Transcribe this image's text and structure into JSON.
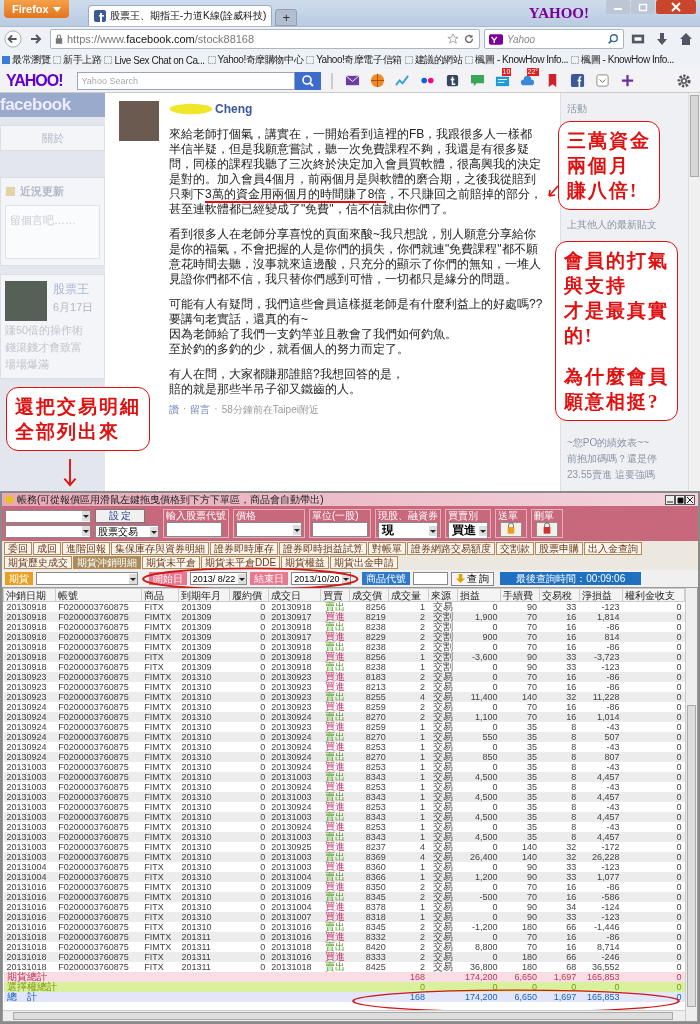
{
  "browser": {
    "menu_button": "Firefox",
    "tabs": [
      {
        "title": "股票王、期指王-力道K線(詮威科技)",
        "selected": true
      }
    ],
    "new_tab": "+",
    "brand": "YAHOO!",
    "url_prefix": "https://www.",
    "url_host": "facebook.com",
    "url_path": "/stock88168",
    "search_placeholder": "Yahoo",
    "bookmarks": [
      {
        "label": "最常瀏覽",
        "kind": "special"
      },
      {
        "label": "新手上路",
        "kind": "page"
      },
      {
        "label": "Live Sex Chat on Ca...",
        "kind": "page"
      },
      {
        "label": "Yahoo!奇摩購物中心",
        "kind": "page"
      },
      {
        "label": "Yahoo!奇摩電子信箱",
        "kind": "page"
      },
      {
        "label": "建議的網站",
        "kind": "page"
      },
      {
        "label": "楓圖 - KnowHow Info...",
        "kind": "page"
      },
      {
        "label": "楓圖 - KnowHow Info...",
        "kind": "page"
      }
    ],
    "toolbar": {
      "logo": "YAHOO!",
      "search_placeholder": "Yahoo Search",
      "news_badge": "10",
      "weather_badge": "22°"
    }
  },
  "facebook": {
    "logo": "facebook",
    "about": "關於",
    "status_tab": "近況更新",
    "status_placeholder": "留個言吧……",
    "side_post": {
      "author": "股票王",
      "date": "6月17日",
      "lines": [
        "賺50倍的操作術",
        "錢滾錢才會致富",
        "場場爆滿"
      ]
    },
    "right_column": [
      "活動",
      "上其他人的最新貼文",
      "~您PO的績效表~~",
      "前抱加碼嗎？還是停",
      "23.55賣進 這要強嗎"
    ]
  },
  "post": {
    "author": "Cheng",
    "paragraphs": [
      {
        "lines": [
          [
            {
              "text": "來給老師打個氣，講實在，一開始看到這裡的FB，我跟很多人一樣都半信半疑，但是我願意嘗試，聽一次免費課程不夠，我還是有很多疑問，同樣的課程我聽了三次終於決定加入會員買軟體，很高興我的決定是對的。加入會員4個月，前兩個月是與軟體的磨合期，之後我從賠到只剩下",
              "underlined": false
            },
            {
              "text": "3萬的資金用兩個月的時間賺了8倍",
              "underlined": true
            },
            {
              "text": "，不只賺回之前賠掉的部分，甚至連軟體都已經變成了\"免費\"，信不信就由你們了。",
              "underlined": false
            }
          ]
        ]
      },
      {
        "lines": [
          [
            {
              "text": "看到很多人在老師分享喜悅的頁面來酸~我只想說，別人願意分享給你是你的福氣，不會把握的人是你們的損失，你們就連\"免費課程\"都不願意花時間去聽，沒事就來這邊酸，只充分的顯示了你們的無知，一堆人見證你們都不信，我只替你們感到可惜，一切都只是緣分的問題。",
              "underlined": false
            }
          ]
        ]
      },
      {
        "lines": [
          [
            {
              "text": "可能有人有疑問，我們這些會員這樣挺老師是有什麼利益上的好處嗎??",
              "underlined": false
            }
          ],
          [
            {
              "text": "要講句老實話，還真的有~",
              "underlined": false
            }
          ],
          [
            {
              "text": "因為老師給了我們一支釣竿並且教會了我們如何釣魚。",
              "underlined": false
            }
          ],
          [
            {
              "text": "至於釣的多釣的少，就看個人的努力而定了。",
              "underlined": false
            }
          ]
        ]
      },
      {
        "lines": [
          [
            {
              "text": "有人在問，大家都賺那誰賠?我想回答的是，",
              "underlined": false
            }
          ],
          [
            {
              "text": "賠的就是那些半吊子卻又鐵齒的人。",
              "underlined": false
            }
          ]
        ]
      }
    ],
    "footer": [
      {
        "text": "讚",
        "kind": "link"
      },
      {
        "text": "·",
        "kind": "dot"
      },
      {
        "text": "留言",
        "kind": "link"
      },
      {
        "text": "·",
        "kind": "dot"
      },
      {
        "text": "58分鐘前在Taipei附近",
        "kind": "time"
      }
    ]
  },
  "annotations": [
    {
      "kind": "profit",
      "blocks": [
        [
          "三萬資金",
          "兩個月",
          "賺八倍!"
        ]
      ]
    },
    {
      "kind": "support",
      "blocks": [
        [
          "會員的打氣",
          "與支持",
          "才是最真實",
          "的!"
        ],
        [
          "為什麼會員",
          "願意相挺?"
        ]
      ]
    },
    {
      "kind": "details",
      "blocks": [
        [
          "還把交易明細",
          "全部列出來"
        ]
      ]
    }
  ],
  "trading_window": {
    "title": "帳務(可從報價區用滑鼠左鍵拖曳價格到下方下單區，商品會自動帶出)",
    "settings_button": "設 定",
    "market_select": "股票交易",
    "groups": [
      {
        "label": "輸入股票代號",
        "kind": "input"
      },
      {
        "label": "價格",
        "kind": "dropdown"
      },
      {
        "label": "單位(一股)",
        "kind": "input"
      },
      {
        "label": "現股、融資券",
        "kind": "select",
        "value": "現"
      },
      {
        "label": "買賣別",
        "kind": "select",
        "value": "買進"
      },
      {
        "label": "送單",
        "kind": "send"
      },
      {
        "label": "刪單",
        "kind": "delete"
      }
    ],
    "tabs": [
      {
        "label": "委回",
        "selected": false
      },
      {
        "label": "成回",
        "selected": false
      },
      {
        "label": "進階回報",
        "selected": false
      },
      {
        "label": "集保庫存與資券明細",
        "selected": false
      },
      {
        "label": "證券即時庫存",
        "selected": false
      },
      {
        "label": "證券即時損益試算",
        "selected": false
      },
      {
        "label": "對帳單",
        "selected": false
      },
      {
        "label": "證券網路交易額度",
        "selected": false
      },
      {
        "label": "交割款",
        "selected": false
      },
      {
        "label": "股票申購",
        "selected": false
      },
      {
        "label": "出入金查詢",
        "selected": false
      },
      {
        "label": "期貨歷史成交",
        "selected": false
      },
      {
        "label": "期貨沖銷明細",
        "selected": true
      },
      {
        "label": "期貨未平倉",
        "selected": false
      },
      {
        "label": "期貨未平倉DDE",
        "selected": false
      },
      {
        "label": "期貨權益",
        "selected": false
      },
      {
        "label": "期貨出金申請",
        "selected": false
      }
    ],
    "filter": {
      "market": "期貨",
      "start_label": "開始日",
      "start_date": "2013/ 8/22",
      "end_label": "結束日",
      "end_date": "2013/10/20",
      "product_label": "商品代號",
      "query_button": "查 詢",
      "last_query": "最後查詢時間：00:09:06"
    },
    "columns": [
      "沖銷日期",
      "帳號",
      "商品",
      "到期年月",
      "履約價",
      "成交日",
      "買賣",
      "成交價",
      "成交量",
      "來源",
      "損益",
      "手續費",
      "交易稅",
      "淨損益",
      "權利金收支"
    ],
    "rows": [
      {
        "kind": "sell",
        "cells": [
          "20130918",
          "F0200003760875",
          "FITX",
          "201309",
          "0",
          "20130918",
          "賣出",
          "8256",
          "1",
          "交易",
          "0",
          "90",
          "33",
          "-123",
          "0"
        ]
      },
      {
        "kind": "buy",
        "cells": [
          "20130918",
          "F0200003760875",
          "FIMTX",
          "201309",
          "0",
          "20130917",
          "買進",
          "8219",
          "2",
          "交割",
          "1,900",
          "70",
          "16",
          "1,814",
          "0"
        ]
      },
      {
        "kind": "sell",
        "cells": [
          "20130918",
          "F0200003760875",
          "FIMTX",
          "201309",
          "0",
          "20130918",
          "賣出",
          "8238",
          "2",
          "交割",
          "0",
          "70",
          "16",
          "-86",
          "0"
        ]
      },
      {
        "kind": "buy",
        "cells": [
          "20130918",
          "F0200003760875",
          "FIMTX",
          "201309",
          "0",
          "20130917",
          "買進",
          "8229",
          "2",
          "交割",
          "900",
          "70",
          "16",
          "814",
          "0"
        ]
      },
      {
        "kind": "sell",
        "cells": [
          "20130918",
          "F0200003760875",
          "FIMTX",
          "201309",
          "0",
          "20130918",
          "賣出",
          "8238",
          "2",
          "交割",
          "0",
          "70",
          "16",
          "-86",
          "0"
        ]
      },
      {
        "kind": "buy",
        "cells": [
          "20130918",
          "F0200003760875",
          "FITX",
          "201309",
          "0",
          "20130918",
          "買進",
          "8256",
          "1",
          "交割",
          "-3,600",
          "90",
          "33",
          "-3,723",
          "0"
        ]
      },
      {
        "kind": "sell",
        "cells": [
          "20130918",
          "F0200003760875",
          "FITX",
          "201309",
          "0",
          "20130918",
          "賣出",
          "8238",
          "1",
          "交割",
          "0",
          "90",
          "33",
          "-123",
          "0"
        ]
      },
      {
        "kind": "buy",
        "cells": [
          "20130923",
          "F0200003760875",
          "FIMTX",
          "201310",
          "0",
          "20130923",
          "買進",
          "8183",
          "2",
          "交易",
          "0",
          "70",
          "16",
          "-86",
          "0"
        ]
      },
      {
        "kind": "buy",
        "cells": [
          "20130923",
          "F0200003760875",
          "FIMTX",
          "201310",
          "0",
          "20130923",
          "買進",
          "8213",
          "2",
          "交易",
          "0",
          "70",
          "16",
          "-86",
          "0"
        ]
      },
      {
        "kind": "sell",
        "cells": [
          "20130923",
          "F0200003760875",
          "FIMTX",
          "201310",
          "0",
          "20130923",
          "賣出",
          "8255",
          "4",
          "交易",
          "11,400",
          "140",
          "32",
          "11,228",
          "0"
        ]
      },
      {
        "kind": "buy",
        "cells": [
          "20130924",
          "F0200003760875",
          "FIMTX",
          "201310",
          "0",
          "20130923",
          "買進",
          "8259",
          "2",
          "交易",
          "0",
          "70",
          "16",
          "-86",
          "0"
        ]
      },
      {
        "kind": "sell",
        "cells": [
          "20130924",
          "F0200003760875",
          "FIMTX",
          "201310",
          "0",
          "20130924",
          "賣出",
          "8270",
          "2",
          "交易",
          "1,100",
          "70",
          "16",
          "1,014",
          "0"
        ]
      },
      {
        "kind": "buy",
        "cells": [
          "20130924",
          "F0200003760875",
          "FIMTX",
          "201310",
          "0",
          "20130923",
          "買進",
          "8259",
          "1",
          "交易",
          "0",
          "35",
          "8",
          "-43",
          "0"
        ]
      },
      {
        "kind": "sell",
        "cells": [
          "20130924",
          "F0200003760875",
          "FIMTX",
          "201310",
          "0",
          "20130924",
          "賣出",
          "8270",
          "1",
          "交易",
          "550",
          "35",
          "8",
          "507",
          "0"
        ]
      },
      {
        "kind": "buy",
        "cells": [
          "20130924",
          "F0200003760875",
          "FIMTX",
          "201310",
          "0",
          "20130924",
          "買進",
          "8253",
          "1",
          "交易",
          "0",
          "35",
          "8",
          "-43",
          "0"
        ]
      },
      {
        "kind": "sell",
        "cells": [
          "20130924",
          "F0200003760875",
          "FIMTX",
          "201310",
          "0",
          "20130924",
          "賣出",
          "8270",
          "1",
          "交易",
          "850",
          "35",
          "8",
          "807",
          "0"
        ]
      },
      {
        "kind": "buy",
        "cells": [
          "20131003",
          "F0200003760875",
          "FIMTX",
          "201310",
          "0",
          "20130924",
          "買進",
          "8253",
          "1",
          "交易",
          "0",
          "35",
          "8",
          "-43",
          "0"
        ]
      },
      {
        "kind": "sell",
        "cells": [
          "20131003",
          "F0200003760875",
          "FIMTX",
          "201310",
          "0",
          "20131003",
          "賣出",
          "8343",
          "1",
          "交易",
          "4,500",
          "35",
          "8",
          "4,457",
          "0"
        ]
      },
      {
        "kind": "buy",
        "cells": [
          "20131003",
          "F0200003760875",
          "FIMTX",
          "201310",
          "0",
          "20130924",
          "買進",
          "8253",
          "1",
          "交易",
          "0",
          "35",
          "8",
          "-43",
          "0"
        ]
      },
      {
        "kind": "sell",
        "cells": [
          "20131003",
          "F0200003760875",
          "FIMTX",
          "201310",
          "0",
          "20131003",
          "賣出",
          "8343",
          "1",
          "交易",
          "4,500",
          "35",
          "8",
          "4,457",
          "0"
        ]
      },
      {
        "kind": "buy",
        "cells": [
          "20131003",
          "F0200003760875",
          "FIMTX",
          "201310",
          "0",
          "20130924",
          "買進",
          "8253",
          "1",
          "交易",
          "0",
          "35",
          "8",
          "-43",
          "0"
        ]
      },
      {
        "kind": "sell",
        "cells": [
          "20131003",
          "F0200003760875",
          "FIMTX",
          "201310",
          "0",
          "20131003",
          "賣出",
          "8343",
          "1",
          "交易",
          "4,500",
          "35",
          "8",
          "4,457",
          "0"
        ]
      },
      {
        "kind": "buy",
        "cells": [
          "20131003",
          "F0200003760875",
          "FIMTX",
          "201310",
          "0",
          "20130924",
          "買進",
          "8253",
          "1",
          "交易",
          "0",
          "35",
          "8",
          "-43",
          "0"
        ]
      },
      {
        "kind": "sell",
        "cells": [
          "20131003",
          "F0200003760875",
          "FIMTX",
          "201310",
          "0",
          "20131003",
          "賣出",
          "8343",
          "1",
          "交易",
          "4,500",
          "35",
          "8",
          "4,457",
          "0"
        ]
      },
      {
        "kind": "buy",
        "cells": [
          "20131003",
          "F0200003760875",
          "FIMTX",
          "201310",
          "0",
          "20130925",
          "買進",
          "8237",
          "4",
          "交易",
          "0",
          "140",
          "32",
          "-172",
          "0"
        ]
      },
      {
        "kind": "sell",
        "cells": [
          "20131003",
          "F0200003760875",
          "FIMTX",
          "201310",
          "0",
          "20131003",
          "賣出",
          "8369",
          "4",
          "交易",
          "26,400",
          "140",
          "32",
          "26,228",
          "0"
        ]
      },
      {
        "kind": "buy",
        "cells": [
          "20131004",
          "F0200003760875",
          "FITX",
          "201310",
          "0",
          "20131003",
          "買進",
          "8360",
          "1",
          "交易",
          "0",
          "90",
          "33",
          "-123",
          "0"
        ]
      },
      {
        "kind": "sell",
        "cells": [
          "20131004",
          "F0200003760875",
          "FITX",
          "201310",
          "0",
          "20131004",
          "賣出",
          "8366",
          "1",
          "交易",
          "1,200",
          "90",
          "33",
          "1,077",
          "0"
        ]
      },
      {
        "kind": "buy",
        "cells": [
          "20131016",
          "F0200003760875",
          "FIMTX",
          "201310",
          "0",
          "20131009",
          "買進",
          "8350",
          "2",
          "交易",
          "0",
          "70",
          "16",
          "-86",
          "0"
        ]
      },
      {
        "kind": "sell",
        "cells": [
          "20131016",
          "F0200003760875",
          "FIMTX",
          "201310",
          "0",
          "20131016",
          "賣出",
          "8345",
          "2",
          "交易",
          "-500",
          "70",
          "16",
          "-586",
          "0"
        ]
      },
      {
        "kind": "buy",
        "cells": [
          "20131016",
          "F0200003760875",
          "FITX",
          "201310",
          "0",
          "20131004",
          "買進",
          "8378",
          "1",
          "交易",
          "0",
          "90",
          "34",
          "-124",
          "0"
        ]
      },
      {
        "kind": "buy",
        "cells": [
          "20131016",
          "F0200003760875",
          "FITX",
          "201310",
          "0",
          "20131007",
          "買進",
          "8318",
          "1",
          "交易",
          "0",
          "90",
          "33",
          "-123",
          "0"
        ]
      },
      {
        "kind": "sell",
        "cells": [
          "20131016",
          "F0200003760875",
          "FITX",
          "201310",
          "0",
          "20131016",
          "賣出",
          "8345",
          "2",
          "交易",
          "-1,200",
          "180",
          "66",
          "-1,446",
          "0"
        ]
      },
      {
        "kind": "buy",
        "cells": [
          "20131018",
          "F0200003760875",
          "FIMTX",
          "201311",
          "0",
          "20131016",
          "買進",
          "8332",
          "2",
          "交易",
          "0",
          "70",
          "16",
          "-86",
          "0"
        ]
      },
      {
        "kind": "sell",
        "cells": [
          "20131018",
          "F0200003760875",
          "FIMTX",
          "201311",
          "0",
          "20131018",
          "賣出",
          "8420",
          "2",
          "交易",
          "8,800",
          "70",
          "16",
          "8,714",
          "0"
        ]
      },
      {
        "kind": "buy",
        "cells": [
          "20131018",
          "F0200003760875",
          "FITX",
          "201311",
          "0",
          "20131016",
          "買進",
          "8333",
          "2",
          "交易",
          "0",
          "180",
          "66",
          "-246",
          "0"
        ]
      },
      {
        "kind": "sell",
        "cells": [
          "20131018",
          "F0200003760875",
          "FITX",
          "201311",
          "0",
          "20131018",
          "賣出",
          "8425",
          "2",
          "交易",
          "36,800",
          "180",
          "68",
          "36,552",
          "0"
        ]
      }
    ],
    "totals": [
      {
        "kind": "futures",
        "label": "期貨總計",
        "qty": "168",
        "pnl": "174,200",
        "fee": "6,650",
        "tax": "1,697",
        "net": "165,853",
        "premium": "0"
      },
      {
        "kind": "options",
        "label": "選擇權總計",
        "qty": "0",
        "pnl": "0",
        "fee": "0",
        "tax": "0",
        "net": "0",
        "premium": "0"
      },
      {
        "kind": "total",
        "label": "總　計",
        "qty": "168",
        "pnl": "174,200",
        "fee": "6,650",
        "tax": "1,697",
        "net": "165,853",
        "premium": "0"
      }
    ]
  }
}
